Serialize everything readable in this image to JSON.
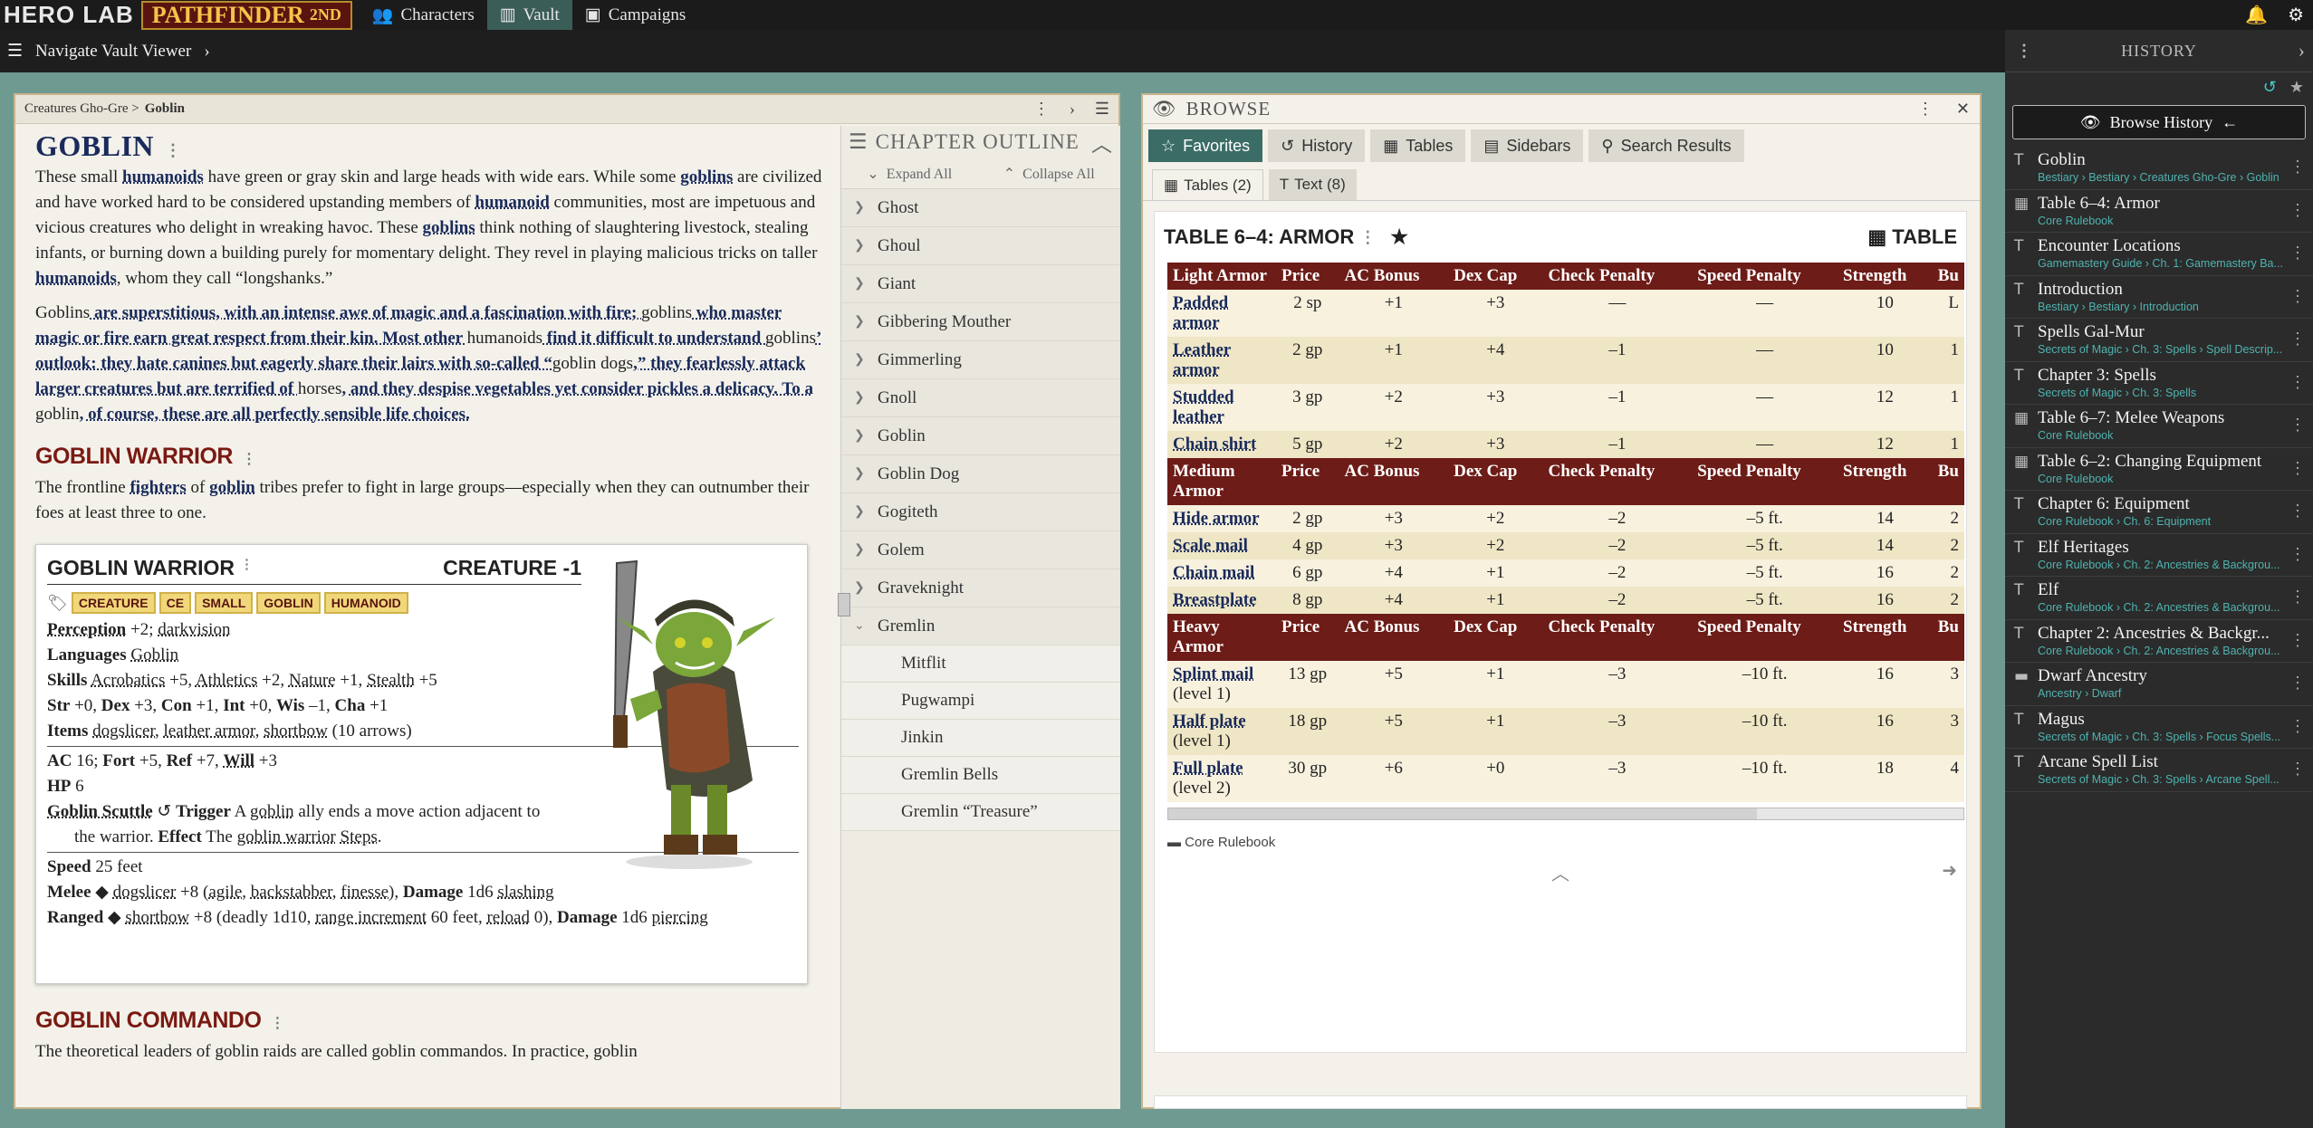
{
  "topbar": {
    "logo": "HERO LAB",
    "game": "PATHFINDER",
    "edition": "2ND",
    "tabs": [
      {
        "label": "Characters"
      },
      {
        "label": "Vault"
      },
      {
        "label": "Campaigns"
      }
    ]
  },
  "subbar": {
    "title": "Navigate Vault Viewer"
  },
  "left": {
    "breadcrumb": "Creatures Gho-Gre",
    "breadcrumb_current": "Goblin",
    "title": "GOBLIN",
    "para1": [
      "These small ",
      "humanoids",
      " have green or gray skin and large heads with wide ears. While some ",
      "goblins",
      " are civilized and have worked hard to be considered upstanding members of ",
      "humanoid",
      " communities, most are impetuous and vicious creatures who delight in wreaking havoc. These ",
      "goblins",
      " think nothing of slaughtering livestock, stealing infants, or burning down a building purely for momentary delight. They revel in playing malicious tricks on taller ",
      "humanoids",
      ", whom they call “longshanks.”"
    ],
    "para2": [
      "Goblins",
      " are superstitious, with an intense awe of magic and a fascination with fire; ",
      "goblins",
      " who master magic or fire earn great respect from their kin. Most other ",
      "humanoids",
      " find it difficult to understand ",
      "goblins",
      "’ outlook: they hate canines but eagerly share their lairs with so-called “",
      "goblin dogs",
      ",” they fearlessly attack larger creatures but are terrified of ",
      "horses",
      ", and they despise vegetables yet consider pickles a delicacy. To a ",
      "goblin",
      ", of course, these are all perfectly sensible life choices."
    ],
    "warrior_heading": "GOBLIN WARRIOR",
    "warrior_para": [
      "The frontline ",
      "fighters",
      " of ",
      "goblin",
      " tribes prefer to fight in large groups—especially when they can outnumber their foes at least three to one."
    ],
    "statblock": {
      "name": "GOBLIN WARRIOR",
      "level": "CREATURE -1",
      "traits": [
        "CREATURE",
        "CE",
        "SMALL",
        "GOBLIN",
        "HUMANOID"
      ],
      "perception_label": "Perception",
      "perception": "+2; ",
      "darkvision": "darkvision",
      "languages_label": "Languages",
      "languages": "Goblin",
      "skills_label": "Skills",
      "skills": [
        [
          "Acrobatics",
          " +5, "
        ],
        [
          "Athletics",
          " +2, "
        ],
        [
          "Nature",
          " +1, "
        ],
        [
          "Stealth",
          " +5"
        ]
      ],
      "abilities": [
        "Str",
        " +0, ",
        "Dex",
        " +3, ",
        "Con",
        " +1, ",
        "Int",
        " +0, ",
        "Wis",
        " –1, ",
        "Cha",
        " +1"
      ],
      "items_label": "Items",
      "items": [
        "dogslicer",
        ", ",
        "leather armor",
        ", ",
        "shortbow",
        " (10 arrows)"
      ],
      "ac_line": [
        "AC",
        " 16; ",
        "Fort",
        " +5, ",
        "Ref",
        " +7, ",
        "Will",
        " +3"
      ],
      "hp_label": "HP",
      "hp": "6",
      "scuttle": [
        "Goblin Scuttle",
        "Trigger",
        " A ",
        "goblin",
        " ally ends a move action adjacent to the warrior. ",
        "Effect",
        " The ",
        "goblin warrior",
        " ",
        "Steps",
        "."
      ],
      "speed_label": "Speed",
      "speed": "25 feet",
      "melee": [
        "Melee",
        "dogslicer",
        " +8 (",
        "agile",
        ", ",
        "backstabber",
        ", ",
        "finesse",
        "), ",
        "Damage",
        " 1d6 ",
        "slashing"
      ],
      "ranged": [
        "Ranged",
        "shortbow",
        " +8 (deadly 1d10, ",
        "range increment",
        " 60 feet, ",
        "reload",
        " 0), ",
        "Damage",
        " 1d6 ",
        "piercing"
      ]
    },
    "commando_heading": "GOBLIN COMMANDO",
    "commando_para": "The theoretical leaders of goblin raids are called goblin commandos. In practice, goblin"
  },
  "outline": {
    "title": "CHAPTER OUTLINE",
    "expand": "Expand All",
    "collapse": "Collapse All",
    "items": [
      "Ghost",
      "Ghoul",
      "Giant",
      "Gibbering Mouther",
      "Gimmerling",
      "Gnoll",
      "Goblin",
      "Goblin Dog",
      "Gogiteth",
      "Golem",
      "Graveknight",
      "Gremlin"
    ],
    "subitems": [
      "Mitflit",
      "Pugwampi",
      "Jinkin",
      "Gremlin Bells",
      "Gremlin “Treasure”"
    ]
  },
  "browse": {
    "title": "BROWSE",
    "tabs": [
      "Favorites",
      "History",
      "Tables",
      "Sidebars",
      "Search Results"
    ],
    "subtabs": [
      "Tables (2)",
      "Text (8)"
    ],
    "table_title": "TABLE 6–4: ARMOR",
    "table_label": "TABLE",
    "columns": [
      "Price",
      "AC Bonus",
      "Dex Cap",
      "Check Penalty",
      "Speed Penalty",
      "Strength",
      "Bu"
    ],
    "groups": [
      {
        "name": "Light Armor",
        "rows": [
          [
            "Padded armor",
            "",
            "2 sp",
            "+1",
            "+3",
            "—",
            "—",
            "10",
            "L"
          ],
          [
            "Leather armor",
            "",
            "2 gp",
            "+1",
            "+4",
            "–1",
            "—",
            "10",
            "1"
          ],
          [
            "Studded leather",
            "",
            "3 gp",
            "+2",
            "+3",
            "–1",
            "—",
            "12",
            "1"
          ],
          [
            "Chain shirt",
            "",
            "5 gp",
            "+2",
            "+3",
            "–1",
            "—",
            "12",
            "1"
          ]
        ]
      },
      {
        "name": "Medium Armor",
        "rows": [
          [
            "Hide armor",
            "",
            "2 gp",
            "+3",
            "+2",
            "–2",
            "–5 ft.",
            "14",
            "2"
          ],
          [
            "Scale mail",
            "",
            "4 gp",
            "+3",
            "+2",
            "–2",
            "–5 ft.",
            "14",
            "2"
          ],
          [
            "Chain mail",
            "",
            "6 gp",
            "+4",
            "+1",
            "–2",
            "–5 ft.",
            "16",
            "2"
          ],
          [
            "Breastplate",
            "",
            "8 gp",
            "+4",
            "+1",
            "–2",
            "–5 ft.",
            "16",
            "2"
          ]
        ]
      },
      {
        "name": "Heavy Armor",
        "rows": [
          [
            "Splint mail",
            "(level 1)",
            "13 gp",
            "+5",
            "+1",
            "–3",
            "–10 ft.",
            "16",
            "3"
          ],
          [
            "Half plate",
            "(level 1)",
            "18 gp",
            "+5",
            "+1",
            "–3",
            "–10 ft.",
            "16",
            "3"
          ],
          [
            "Full plate",
            "(level 2)",
            "30 gp",
            "+6",
            "+0",
            "–3",
            "–10 ft.",
            "18",
            "4"
          ]
        ]
      }
    ],
    "source": "Core Rulebook"
  },
  "history": {
    "title": "HISTORY",
    "browse_btn": "Browse History",
    "items": [
      {
        "icon": "T",
        "title": "Goblin",
        "sub": "Bestiary › Bestiary › Creatures Gho-Gre › Goblin"
      },
      {
        "icon": "▦",
        "title": "Table 6–4: Armor",
        "sub": "Core Rulebook"
      },
      {
        "icon": "T",
        "title": "Encounter Locations",
        "sub": "Gamemastery Guide › Ch. 1: Gamemastery Ba..."
      },
      {
        "icon": "T",
        "title": "Introduction",
        "sub": "Bestiary › Bestiary › Introduction"
      },
      {
        "icon": "T",
        "title": "Spells Gal-Mur",
        "sub": "Secrets of Magic › Ch. 3: Spells › Spell Descrip..."
      },
      {
        "icon": "T",
        "title": "Chapter 3: Spells",
        "sub": "Secrets of Magic › Ch. 3: Spells"
      },
      {
        "icon": "▦",
        "title": "Table 6–7: Melee Weapons",
        "sub": "Core Rulebook"
      },
      {
        "icon": "▦",
        "title": "Table 6–2: Changing Equipment",
        "sub": "Core Rulebook"
      },
      {
        "icon": "T",
        "title": "Chapter 6: Equipment",
        "sub": "Core Rulebook › Ch. 6: Equipment"
      },
      {
        "icon": "T",
        "title": "Elf Heritages",
        "sub": "Core Rulebook › Ch. 2: Ancestries & Backgrou..."
      },
      {
        "icon": "T",
        "title": "Elf",
        "sub": "Core Rulebook › Ch. 2: Ancestries & Backgrou..."
      },
      {
        "icon": "T",
        "title": "Chapter 2: Ancestries & Backgr...",
        "sub": "Core Rulebook › Ch. 2: Ancestries & Backgrou..."
      },
      {
        "icon": "▬",
        "title": "Dwarf Ancestry",
        "sub": "Ancestry › Dwarf"
      },
      {
        "icon": "T",
        "title": "Magus",
        "sub": "Secrets of Magic › Ch. 3: Spells › Focus Spells..."
      },
      {
        "icon": "T",
        "title": "Arcane Spell List",
        "sub": "Secrets of Magic › Ch. 3: Spells › Arcane Spell..."
      }
    ]
  }
}
